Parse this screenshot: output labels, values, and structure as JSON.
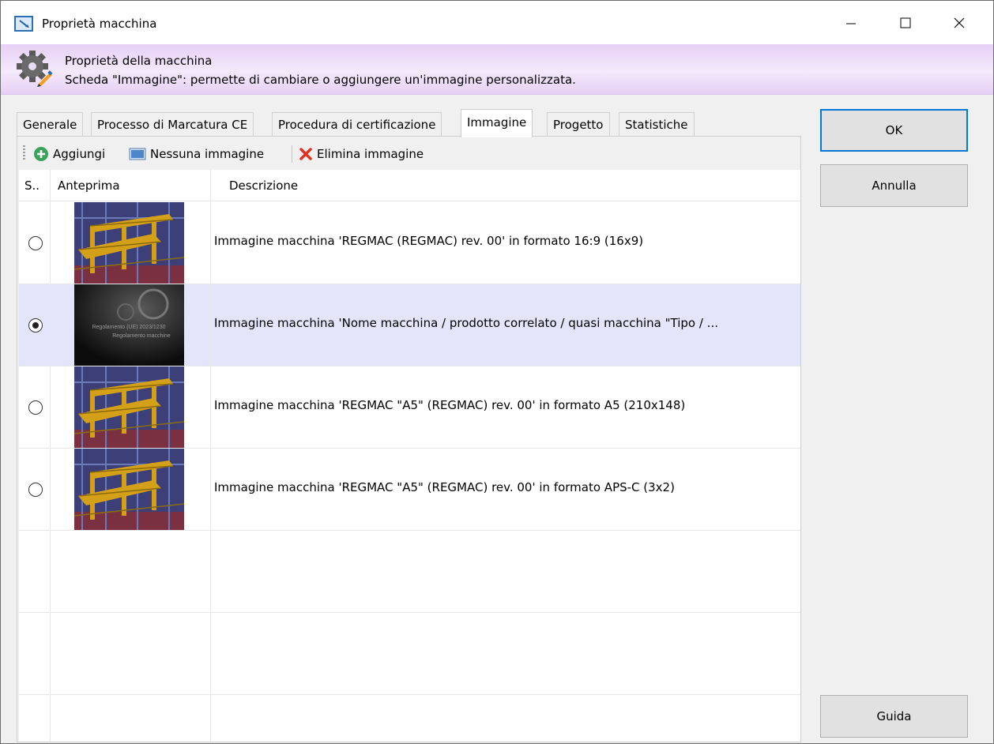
{
  "window": {
    "title": "Proprietà macchina"
  },
  "header": {
    "title": "Proprietà della macchina",
    "subtitle": "Scheda \"Immagine\": permette di cambiare o aggiungere un'immagine personalizzata."
  },
  "tabs": [
    {
      "label": "Generale"
    },
    {
      "label": "Processo di Marcatura CE"
    },
    {
      "label": "Procedura di certificazione"
    },
    {
      "label": "Immagine"
    },
    {
      "label": "Progetto"
    },
    {
      "label": "Statistiche"
    }
  ],
  "active_tab": "Immagine",
  "toolbar": {
    "add_label": "Aggiungi",
    "none_label": "Nessuna immagine",
    "delete_label": "Elimina immagine"
  },
  "grid": {
    "columns": [
      "S..",
      "Anteprima",
      "Descrizione"
    ],
    "rows": [
      {
        "selected": false,
        "thumbnail": "machine-render",
        "description": "Immagine macchina 'REGMAC (REGMAC) rev. 00' in formato 16:9 (16x9)"
      },
      {
        "selected": true,
        "thumbnail": "dark-regulation",
        "thumb_text_1": "Regolamento (UE) 2023/1230",
        "thumb_text_2": "Regolamento macchine",
        "description": "Immagine macchina 'Nome macchina / prodotto correlato / quasi macchina \"Tipo / ..."
      },
      {
        "selected": false,
        "thumbnail": "machine-render",
        "description": "Immagine macchina 'REGMAC \"A5\" (REGMAC) rev. 00' in formato A5 (210x148)"
      },
      {
        "selected": false,
        "thumbnail": "machine-render",
        "description": "Immagine macchina 'REGMAC \"A5\" (REGMAC) rev. 00' in formato APS-C (3x2)"
      }
    ]
  },
  "buttons": {
    "ok": "OK",
    "cancel": "Annulla",
    "help": "Guida"
  },
  "colors": {
    "header_band": "#ecdcf8",
    "selected_row": "#e4e5fa",
    "default_button_border": "#0078d7",
    "delete_icon": "#e0301e",
    "add_icon": "#3aa35a"
  }
}
